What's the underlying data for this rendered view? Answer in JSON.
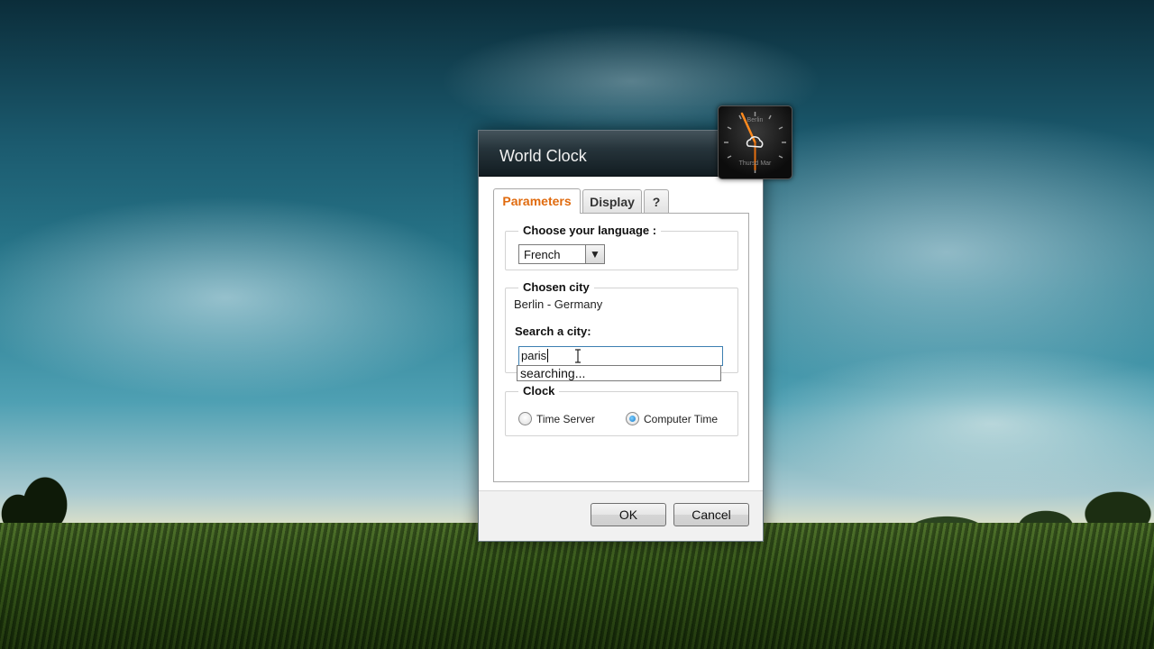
{
  "dialog": {
    "title": "World Clock",
    "tabs": [
      {
        "label": "Parameters",
        "active": true
      },
      {
        "label": "Display",
        "active": false
      },
      {
        "label": "?",
        "active": false
      }
    ],
    "language": {
      "legend": "Choose your language :",
      "selected": "French"
    },
    "city": {
      "legend": "Chosen city",
      "current": "Berlin - Germany",
      "search_label": "Search a city:",
      "search_value": "paris",
      "suggestion": "searching..."
    },
    "clock": {
      "legend": "Clock",
      "options": [
        {
          "label": "Time Server",
          "selected": false
        },
        {
          "label": "Computer Time",
          "selected": true
        }
      ]
    },
    "buttons": {
      "ok": "OK",
      "cancel": "Cancel"
    }
  },
  "gadget": {
    "city": "Berlin",
    "date": "Thursd Mar",
    "weather_icon": "cloud-icon"
  },
  "colors": {
    "active_tab": "#e06b0f",
    "focus_border": "#3c7fb1",
    "radio_selected": "#1478c8"
  }
}
